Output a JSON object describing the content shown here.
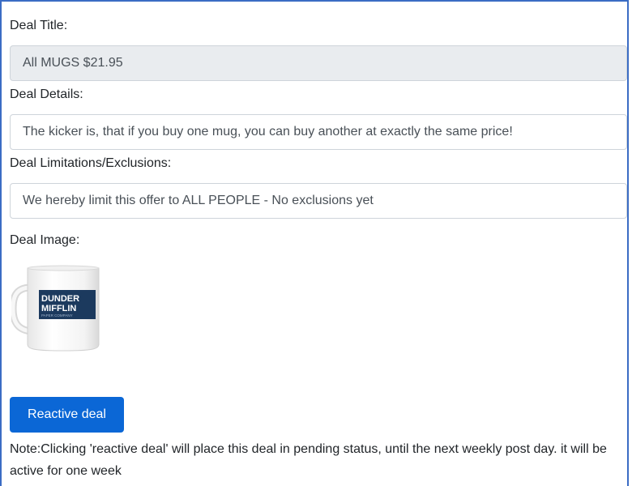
{
  "form": {
    "title_label": "Deal Title:",
    "title_value": "All MUGS $21.95",
    "details_label": "Deal Details:",
    "details_value": "The kicker is, that if you buy one mug, you can buy another at exactly the same price!",
    "limitations_label": "Deal Limitations/Exclusions:",
    "limitations_value": "We hereby limit this offer to ALL PEOPLE - No exclusions yet",
    "image_label": "Deal Image:",
    "image": {
      "logo_line1": "DUNDER",
      "logo_line2": "MIFFLIN",
      "logo_sub": "PAPER COMPANY"
    },
    "button_label": "Reactive deal",
    "note": "Note:Clicking 'reactive deal' will place this deal in pending status, until the next weekly post day. it will be active for one week"
  },
  "colors": {
    "button": "#0b67d6",
    "readonly_bg": "#e9ecef",
    "frame_border": "#3b6cc4",
    "logo_bg": "#1c3a5e"
  }
}
